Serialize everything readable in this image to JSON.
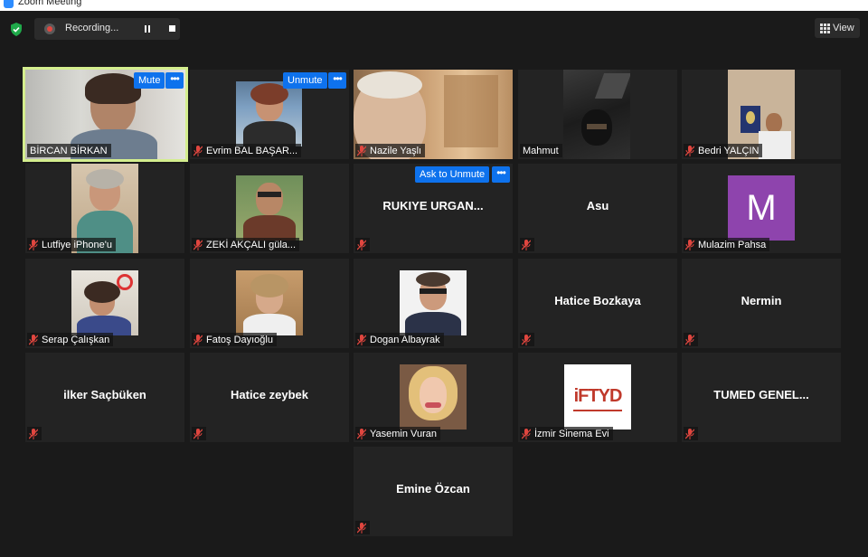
{
  "window": {
    "title": "Zoom Meeting"
  },
  "topbar": {
    "recording_label": "Recording...",
    "view_label": "View"
  },
  "controls": {
    "mute": "Mute",
    "unmute": "Unmute",
    "ask_to_unmute": "Ask to Unmute",
    "more": "•••"
  },
  "colors": {
    "accent": "#0e72ed",
    "active_speaker": "#d4ee8e",
    "muted_icon": "#e0463f",
    "tile": "#232323"
  },
  "participants": [
    {
      "name": "BİRCAN BİRKAN",
      "label": "BİRCAN BİRKAN",
      "muted": false,
      "video": true,
      "active": true
    },
    {
      "name": "Evrim BAL BAŞAR...",
      "label": "Evrim BAL BAŞAR...",
      "muted": true,
      "video": true
    },
    {
      "name": "Nazile Yaşlı",
      "label": "Nazile Yaşlı",
      "muted": true,
      "video": true
    },
    {
      "name": "Mahmut",
      "label": "Mahmut",
      "muted": false,
      "video": true
    },
    {
      "name": "Bedri YALÇIN",
      "label": "Bedri YALÇIN",
      "muted": true,
      "video": true
    },
    {
      "name": "Lutfiye iPhone'u",
      "label": "Lutfiye iPhone'u",
      "muted": true,
      "video": true
    },
    {
      "name": "ZEKİ AKÇALI güla...",
      "label": "ZEKİ AKÇALI güla...",
      "muted": true,
      "video": true
    },
    {
      "name": "RUKIYE URGAN...",
      "muted": true,
      "video": false
    },
    {
      "name": "Asu",
      "muted": true,
      "video": false
    },
    {
      "name": "Mulazim Pahsa",
      "label": "Mulazim Pahsa",
      "muted": true,
      "avatar_letter": "M",
      "avatar_color": "#8e44ad"
    },
    {
      "name": "Serap Çalışkan",
      "label": "Serap Çalışkan",
      "muted": true,
      "video": true
    },
    {
      "name": "Fatoş Dayıoğlu",
      "label": "Fatoş Dayıoğlu",
      "muted": true,
      "video": true
    },
    {
      "name": "Dogan Albayrak",
      "label": "Dogan Albayrak",
      "muted": true,
      "video": true
    },
    {
      "name": "Hatice Bozkaya",
      "muted": true,
      "video": false
    },
    {
      "name": "Nermin",
      "muted": true,
      "video": false
    },
    {
      "name": "ilker Saçbüken",
      "muted": true,
      "video": false
    },
    {
      "name": "Hatice zeybek",
      "muted": true,
      "video": false
    },
    {
      "name": "Yasemin Vuran",
      "label": "Yasemin Vuran",
      "muted": true,
      "video": true
    },
    {
      "name": "İzmir Sinema Evi",
      "label": "İzmir Sinema Evi",
      "muted": true,
      "video": true,
      "logo_text": "iFTYD"
    },
    {
      "name": "TUMED  GENEL...",
      "muted": true,
      "video": false
    },
    {
      "name": "Emine Özcan",
      "muted": true,
      "video": false
    }
  ]
}
